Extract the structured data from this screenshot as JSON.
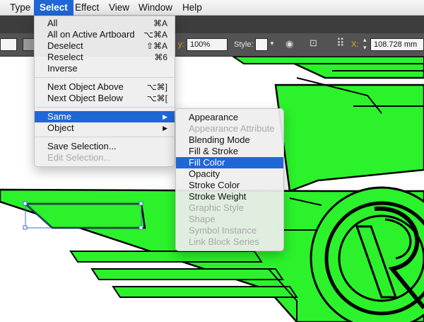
{
  "menubar": {
    "items": [
      {
        "label": "Type"
      },
      {
        "label": "Select"
      },
      {
        "label": "Effect"
      },
      {
        "label": "View"
      },
      {
        "label": "Window"
      },
      {
        "label": "Help"
      }
    ]
  },
  "control_bar": {
    "opacity_label": "y:",
    "opacity_value": "100%",
    "style_label": "Style:",
    "x_label": "X:",
    "x_value": "108.728 mm"
  },
  "select_menu": {
    "items": [
      {
        "label": "All",
        "shortcut": "⌘A"
      },
      {
        "label": "All on Active Artboard",
        "shortcut": "⌥⌘A"
      },
      {
        "label": "Deselect",
        "shortcut": "⇧⌘A"
      },
      {
        "label": "Reselect",
        "shortcut": "⌘6"
      },
      {
        "label": "Inverse",
        "shortcut": ""
      },
      {
        "label": "Next Object Above",
        "shortcut": "⌥⌘]"
      },
      {
        "label": "Next Object Below",
        "shortcut": "⌥⌘["
      },
      {
        "label": "Same",
        "shortcut": ""
      },
      {
        "label": "Object",
        "shortcut": ""
      },
      {
        "label": "Save Selection...",
        "shortcut": ""
      },
      {
        "label": "Edit Selection...",
        "shortcut": ""
      }
    ]
  },
  "same_submenu": {
    "items": [
      {
        "label": "Appearance"
      },
      {
        "label": "Appearance Attribute"
      },
      {
        "label": "Blending Mode"
      },
      {
        "label": "Fill & Stroke"
      },
      {
        "label": "Fill Color"
      },
      {
        "label": "Opacity"
      },
      {
        "label": "Stroke Color"
      },
      {
        "label": "Stroke Weight"
      },
      {
        "label": "Graphic Style"
      },
      {
        "label": "Shape"
      },
      {
        "label": "Symbol Instance"
      },
      {
        "label": "Link Block Series"
      }
    ]
  },
  "colors": {
    "menu_highlight": "#1f67d6",
    "artwork_fill": "#2bf22b",
    "artwork_stroke": "#000000",
    "selection": "#3f6fd6"
  },
  "icons": [
    "submenu-arrow-icon",
    "recolor-icon",
    "align-icon",
    "transform-grid-icon",
    "stepper-icon"
  ]
}
